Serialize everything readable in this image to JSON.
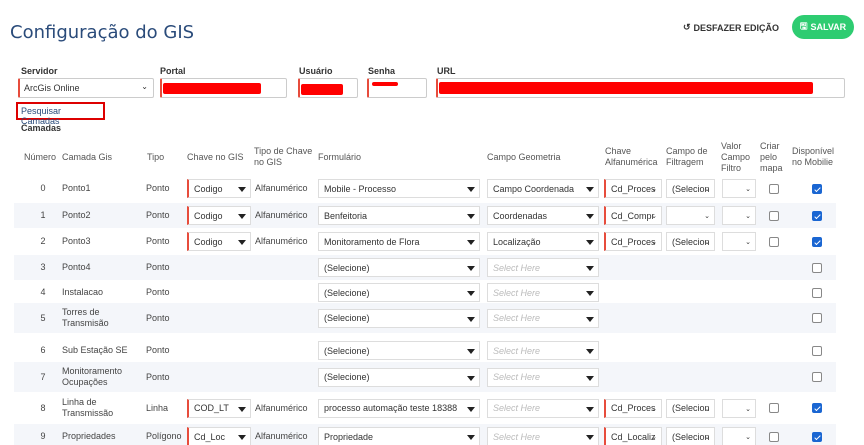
{
  "header": {
    "title": "Configuração do GIS",
    "undo_label": "DESFAZER EDIÇÃO",
    "save_label": "SALVAR"
  },
  "form": {
    "servidor_label": "Servidor",
    "servidor_value": "ArcGis Online",
    "portal_label": "Portal",
    "usuario_label": "Usuário",
    "senha_label": "Senha",
    "url_label": "URL"
  },
  "pesquisar_label": "Pesquisar Camadas",
  "camadas_label": "Camadas",
  "columns": {
    "numero": "Número",
    "camada": "Camada Gis",
    "tipo": "Tipo",
    "chave": "Chave no GIS",
    "tipo_chave": "Tipo de Chave no GIS",
    "formulario": "Formulário",
    "campo_geo": "Campo Geometria",
    "chave_alfa": "Chave Alfanumérica",
    "campo_filtragem": "Campo de Filtragem",
    "valor_campo": "Valor Campo Filtro",
    "criar_mapa": "Criar pelo mapa",
    "disponivel": "Disponível no Mobilie"
  },
  "rows": [
    {
      "num": "0",
      "camada": "Ponto1",
      "tipo": "Ponto",
      "chave": "Codigo",
      "tipo_chave": "Alfanumérico",
      "form": "Mobile - Processo",
      "geo": "Campo Coordenada",
      "alfa": "Cd_Proces",
      "filt": "(Selecion",
      "disp": true
    },
    {
      "num": "1",
      "camada": "Ponto2",
      "tipo": "Ponto",
      "chave": "Codigo",
      "tipo_chave": "Alfanumérico",
      "form": "Benfeitoria",
      "geo": "Coordenadas",
      "alfa": "Cd_Compr",
      "filt": "",
      "disp": true
    },
    {
      "num": "2",
      "camada": "Ponto3",
      "tipo": "Ponto",
      "chave": "Codigo",
      "tipo_chave": "Alfanumérico",
      "form": "Monitoramento de Flora",
      "geo": "Localização",
      "alfa": "Cd_Proces",
      "filt": "(Selecion",
      "disp": true
    },
    {
      "num": "3",
      "camada": "Ponto4",
      "tipo": "Ponto",
      "form": "(Selecione)",
      "geo": "Select Here",
      "disp": false
    },
    {
      "num": "4",
      "camada": "Instalacao",
      "tipo": "Ponto",
      "form": "(Selecione)",
      "geo": "Select Here",
      "disp": false
    },
    {
      "num": "5",
      "camada": "Torres de Transmisão",
      "tipo": "Ponto",
      "form": "(Selecione)",
      "geo": "Select Here",
      "disp": false
    },
    {
      "num": "6",
      "camada": "Sub Estação SE",
      "tipo": "Ponto",
      "form": "(Selecione)",
      "geo": "Select Here",
      "disp": false
    },
    {
      "num": "7",
      "camada": "Monitoramento Ocupações",
      "tipo": "Ponto",
      "form": "(Selecione)",
      "geo": "Select Here",
      "disp": false
    },
    {
      "num": "8",
      "camada": "Linha de Transmissão",
      "tipo": "Linha",
      "chave": "COD_LT",
      "tipo_chave": "Alfanumérico",
      "form": "processo automação teste 18388",
      "geo": "Select Here",
      "alfa": "Cd_Proces",
      "filt": "(Selecion",
      "disp": true
    },
    {
      "num": "9",
      "camada": "Propriedades",
      "tipo": "Polígono",
      "chave": "Cd_Loc",
      "tipo_chave": "Alfanumérico",
      "form": "Propriedade",
      "geo": "Select Here",
      "alfa": "Cd_Localiz",
      "filt": "(Selecion",
      "disp": true
    }
  ]
}
